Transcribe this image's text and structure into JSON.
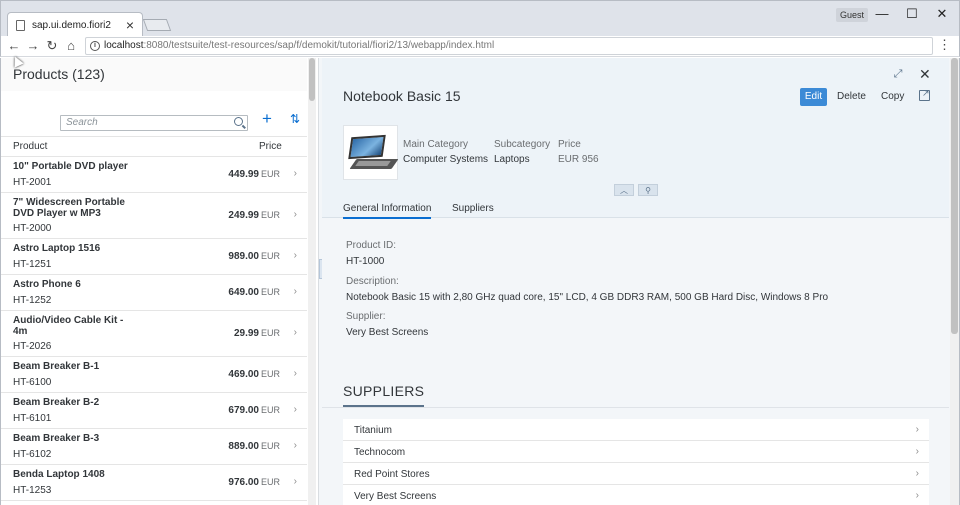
{
  "browser": {
    "tab_title": "sap.ui.demo.fiori2",
    "guest_label": "Guest",
    "url_host": "localhost",
    "url_rest": ":8080/testsuite/test-resources/sap/f/demokit/tutorial/fiori2/13/webapp/index.html"
  },
  "master": {
    "title": "Products (123)",
    "search_placeholder": "Search",
    "col_product": "Product",
    "col_price": "Price",
    "currency": "EUR",
    "items": [
      {
        "name": "10\" Portable DVD player",
        "id": "HT-2001",
        "price": "449.99"
      },
      {
        "name": "7\" Widescreen Portable DVD Player w MP3",
        "id": "HT-2000",
        "price": "249.99"
      },
      {
        "name": "Astro Laptop 1516",
        "id": "HT-1251",
        "price": "989.00"
      },
      {
        "name": "Astro Phone 6",
        "id": "HT-1252",
        "price": "649.00"
      },
      {
        "name": "Audio/Video Cable Kit - 4m",
        "id": "HT-2026",
        "price": "29.99"
      },
      {
        "name": "Beam Breaker B-1",
        "id": "HT-6100",
        "price": "469.00"
      },
      {
        "name": "Beam Breaker B-2",
        "id": "HT-6101",
        "price": "679.00"
      },
      {
        "name": "Beam Breaker B-3",
        "id": "HT-6102",
        "price": "889.00"
      },
      {
        "name": "Benda Laptop 1408",
        "id": "HT-1253",
        "price": "976.00"
      }
    ]
  },
  "detail": {
    "title": "Notebook Basic 15",
    "edit_label": "Edit",
    "delete_label": "Delete",
    "copy_label": "Copy",
    "main_category_label": "Main Category",
    "main_category": "Computer Systems",
    "subcategory_label": "Subcategory",
    "subcategory": "Laptops",
    "price_label": "Price",
    "price": "EUR 956",
    "tabs": [
      "General Information",
      "Suppliers"
    ],
    "product_id_label": "Product ID:",
    "product_id": "HT-1000",
    "description_label": "Description:",
    "description": "Notebook Basic 15 with 2,80 GHz quad core, 15\" LCD, 4 GB DDR3 RAM, 500 GB Hard Disc, Windows 8 Pro",
    "supplier_label": "Supplier:",
    "supplier": "Very Best Screens",
    "suppliers_section_title": "SUPPLIERS",
    "suppliers": [
      "Titanium",
      "Technocom",
      "Red Point Stores",
      "Very Best Screens"
    ]
  },
  "colors": {
    "accent": "#0a6ed1",
    "header_bg": "#edf3f8",
    "edit_button": "#3c8ad6"
  }
}
